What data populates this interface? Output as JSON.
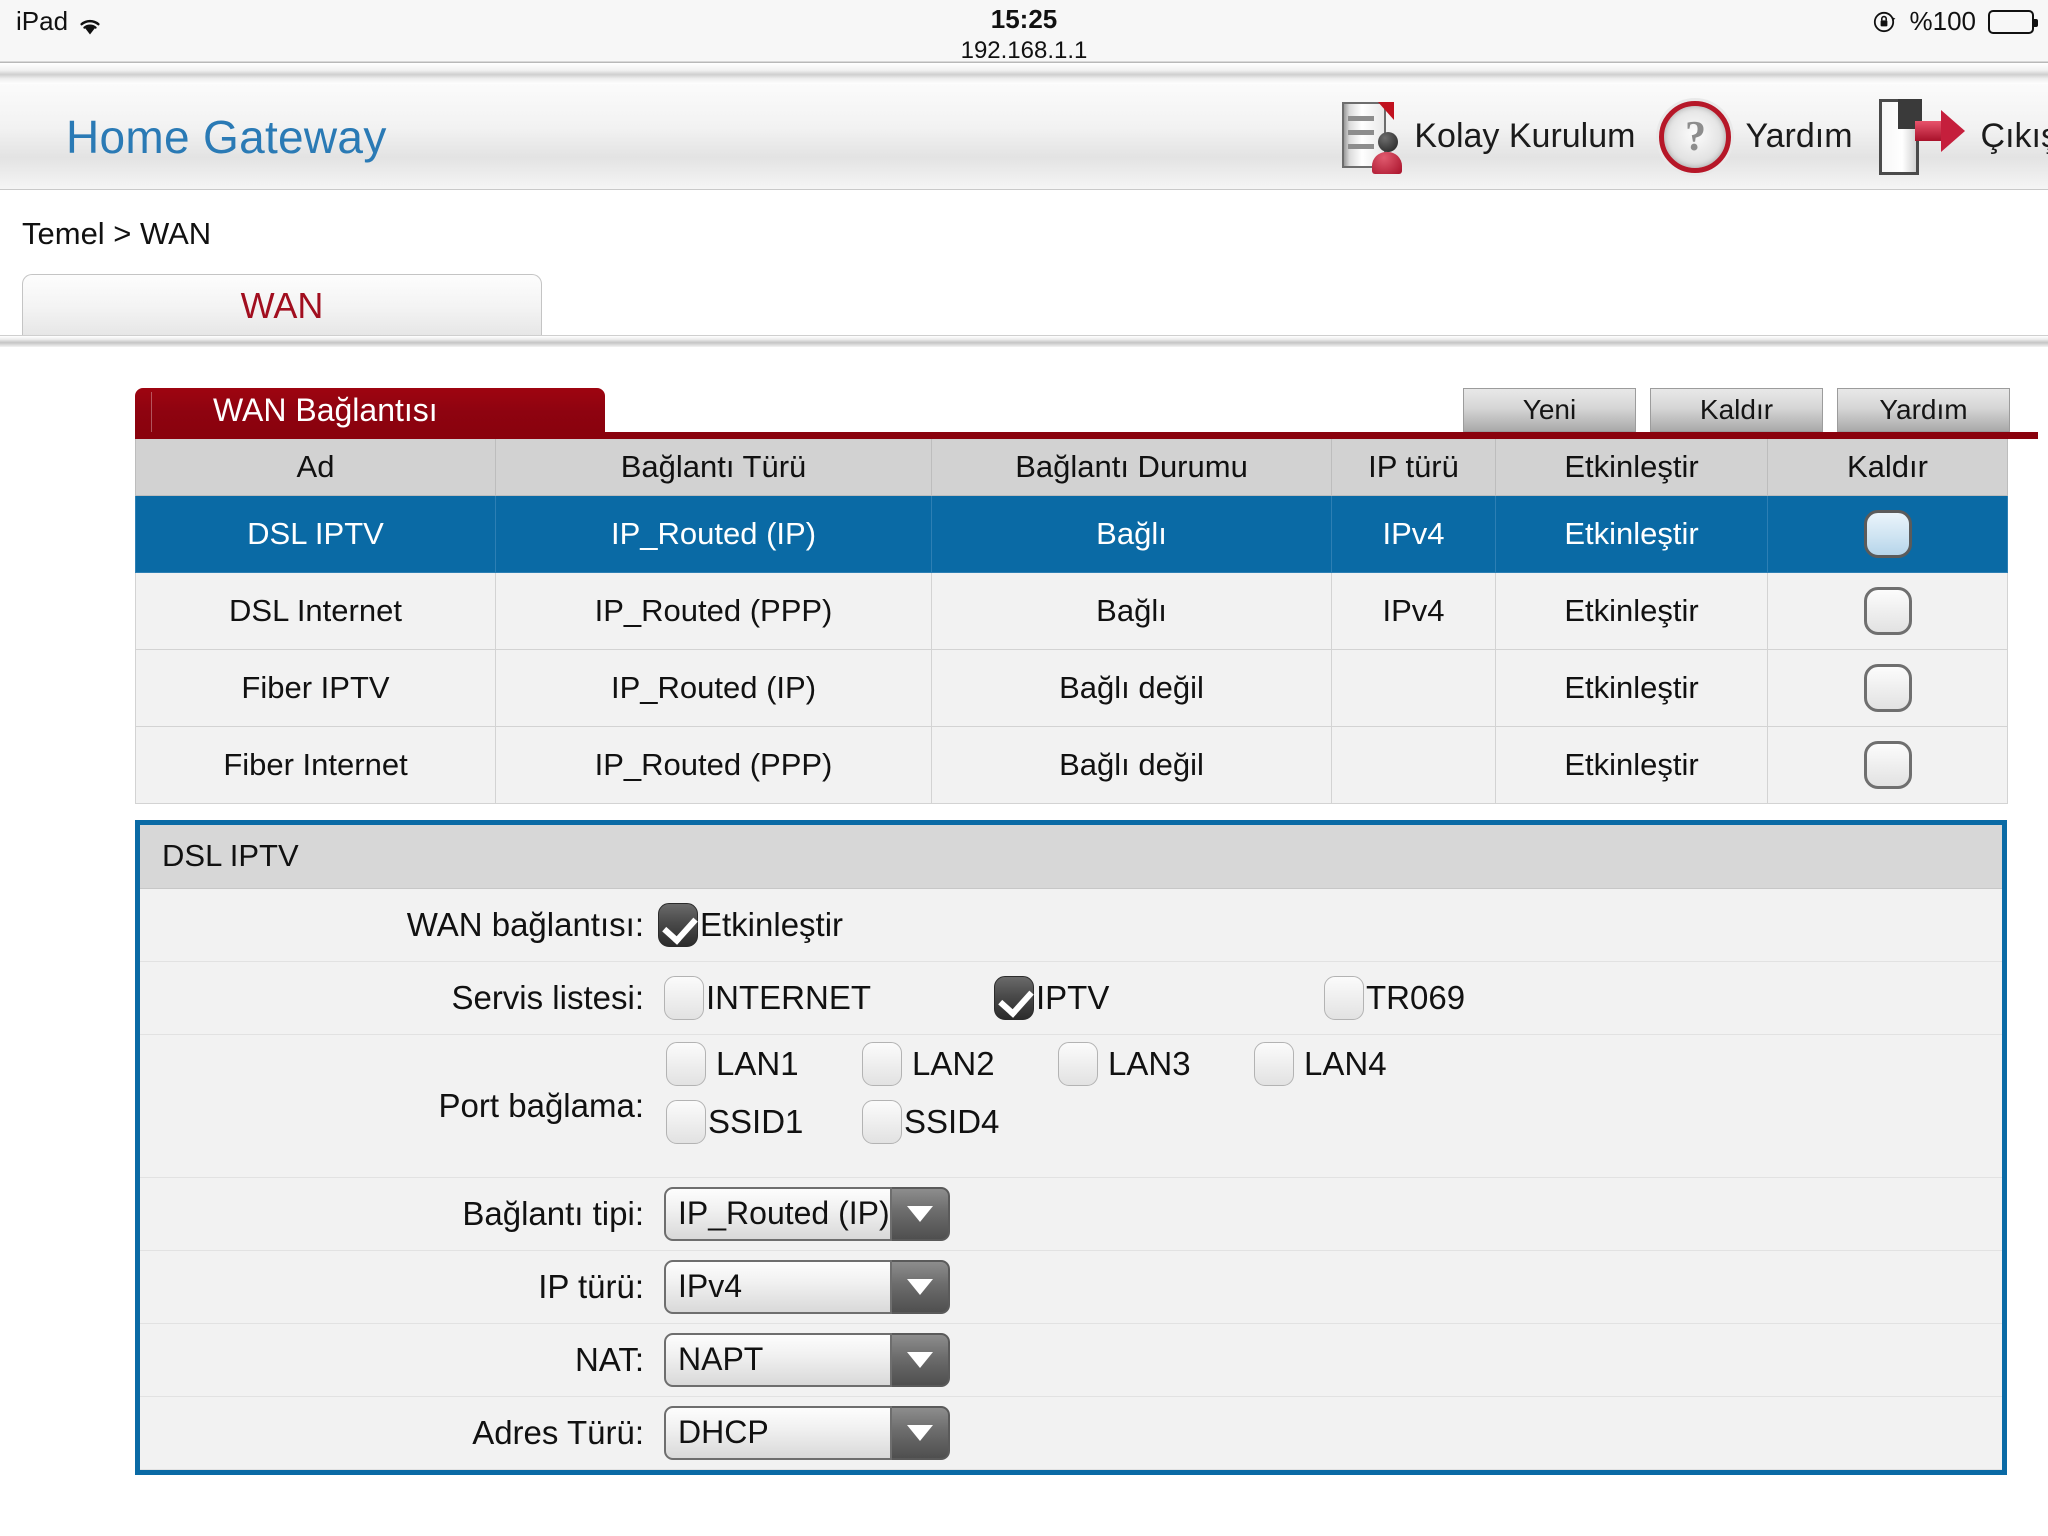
{
  "status_bar": {
    "device": "iPad",
    "wifi_icon": "wifi-icon",
    "time": "15:25",
    "url": "192.168.1.1",
    "rotation_lock_icon": "rotation-lock-icon",
    "battery_label": "%100",
    "battery_icon": "battery-full-icon"
  },
  "header": {
    "title": "Home Gateway",
    "actions": [
      {
        "label": "Kolay Kurulum",
        "icon": "easy-setup-document-icon"
      },
      {
        "label": "Yardım",
        "icon": "help-question-icon"
      },
      {
        "label": "Çıkış",
        "icon": "exit-door-icon"
      }
    ]
  },
  "breadcrumb": "Temel > WAN",
  "tabs": [
    {
      "label": "WAN",
      "active": true
    }
  ],
  "panel": {
    "title": "WAN Bağlantısı",
    "toolbar": [
      {
        "label": "Yeni"
      },
      {
        "label": "Kaldır"
      },
      {
        "label": "Yardım"
      }
    ],
    "columns": [
      "Ad",
      "Bağlantı Türü",
      "Bağlantı Durumu",
      "IP türü",
      "Etkinleştir",
      "Kaldır"
    ],
    "rows": [
      {
        "ad": "DSL IPTV",
        "tur": "IP_Routed (IP)",
        "durum": "Bağlı",
        "ip": "IPv4",
        "etkin": "Etkinleştir",
        "kaldir_checked": false,
        "selected": true
      },
      {
        "ad": "DSL Internet",
        "tur": "IP_Routed (PPP)",
        "durum": "Bağlı",
        "ip": "IPv4",
        "etkin": "Etkinleştir",
        "kaldir_checked": false,
        "selected": false
      },
      {
        "ad": "Fiber IPTV",
        "tur": "IP_Routed (IP)",
        "durum": "Bağlı değil",
        "ip": "",
        "etkin": "Etkinleştir",
        "kaldir_checked": false,
        "selected": false
      },
      {
        "ad": "Fiber Internet",
        "tur": "IP_Routed (PPP)",
        "durum": "Bağlı değil",
        "ip": "",
        "etkin": "Etkinleştir",
        "kaldir_checked": false,
        "selected": false
      }
    ]
  },
  "detail": {
    "title": "DSL IPTV",
    "wan_connection": {
      "label": "WAN bağlantısı:",
      "checkbox_label": "Etkinleştir",
      "checked": true
    },
    "service_list": {
      "label": "Servis listesi:",
      "items": [
        {
          "label": "INTERNET",
          "checked": false
        },
        {
          "label": "IPTV",
          "checked": true
        },
        {
          "label": "TR069",
          "checked": false
        }
      ]
    },
    "port_binding": {
      "label": "Port bağlama:",
      "items": [
        {
          "label": "LAN1",
          "checked": false
        },
        {
          "label": "LAN2",
          "checked": false
        },
        {
          "label": "LAN3",
          "checked": false
        },
        {
          "label": "LAN4",
          "checked": false
        },
        {
          "label": "SSID1",
          "checked": false
        },
        {
          "label": "SSID4",
          "checked": false
        }
      ]
    },
    "selects": [
      {
        "label": "Bağlantı tipi:",
        "value": "IP_Routed (IP)"
      },
      {
        "label": "IP türü:",
        "value": "IPv4"
      },
      {
        "label": "NAT:",
        "value": "NAPT"
      },
      {
        "label": "Adres Türü:",
        "value": "DHCP"
      }
    ]
  },
  "colors": {
    "brand_red": "#8a020d",
    "selected_blue": "#0a6aa5",
    "title_blue": "#2a7ab5",
    "tab_red": "#a10e1f"
  }
}
